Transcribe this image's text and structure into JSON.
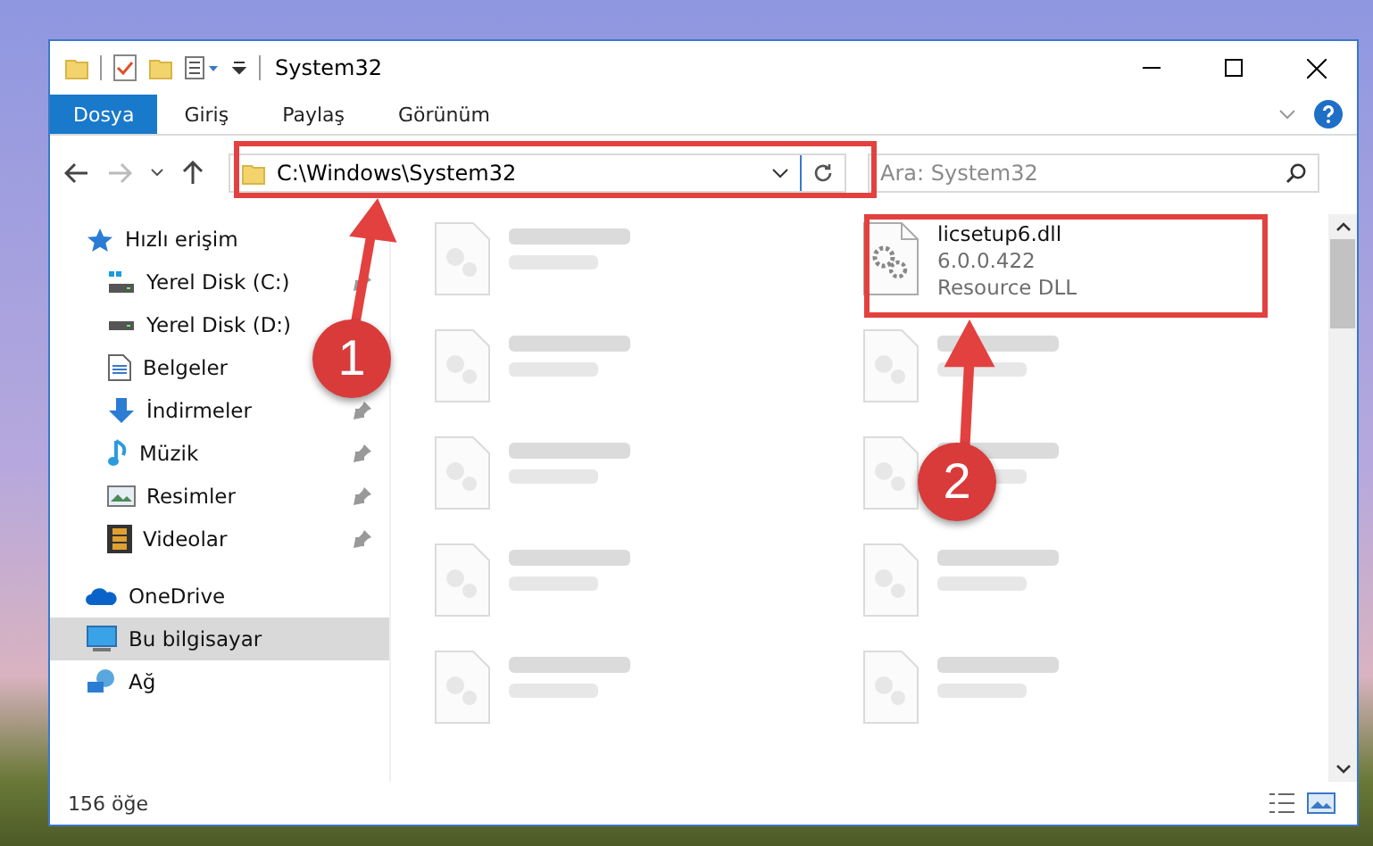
{
  "window": {
    "title": "System32"
  },
  "ribbon_tabs": [
    {
      "label": "Dosya",
      "selected": true
    },
    {
      "label": "Giriş",
      "selected": false
    },
    {
      "label": "Paylaş",
      "selected": false
    },
    {
      "label": "Görünüm",
      "selected": false
    }
  ],
  "address_bar": {
    "path": "C:\\Windows\\System32"
  },
  "search": {
    "placeholder": "Ara: System32"
  },
  "sidebar": {
    "items": [
      {
        "label": "Hızlı erişim",
        "kind": "star",
        "selected": false,
        "children": [
          {
            "label": "Yerel Disk (C:)",
            "kind": "system-drive",
            "pinned": true,
            "selected": false
          },
          {
            "label": "Yerel Disk (D:)",
            "kind": "drive",
            "pinned": false,
            "selected": false
          },
          {
            "label": "Belgeler",
            "kind": "document",
            "pinned": false,
            "selected": false
          },
          {
            "label": "İndirmeler",
            "kind": "download",
            "pinned": true,
            "selected": false
          },
          {
            "label": "Müzik",
            "kind": "music",
            "pinned": true,
            "selected": false
          },
          {
            "label": "Resimler",
            "kind": "picture",
            "pinned": true,
            "selected": false
          },
          {
            "label": "Videolar",
            "kind": "video",
            "pinned": true,
            "selected": false
          }
        ]
      },
      {
        "label": "OneDrive",
        "kind": "cloud",
        "selected": false
      },
      {
        "label": "Bu bilgisayar",
        "kind": "computer",
        "selected": true
      },
      {
        "label": "Ağ",
        "kind": "network",
        "selected": false
      }
    ]
  },
  "files": [
    {
      "kind": "blurred"
    },
    {
      "kind": "file",
      "name": "licsetup6.dll",
      "version": "6.0.0.422",
      "type": "Resource DLL"
    },
    {
      "kind": "blurred"
    },
    {
      "kind": "blurred"
    },
    {
      "kind": "blurred"
    },
    {
      "kind": "blurred"
    },
    {
      "kind": "blurred"
    },
    {
      "kind": "blurred"
    },
    {
      "kind": "blurred"
    },
    {
      "kind": "blurred"
    }
  ],
  "status_bar": {
    "item_count": "156 öğe"
  },
  "annotations": [
    {
      "label": "1"
    },
    {
      "label": "2"
    }
  ]
}
